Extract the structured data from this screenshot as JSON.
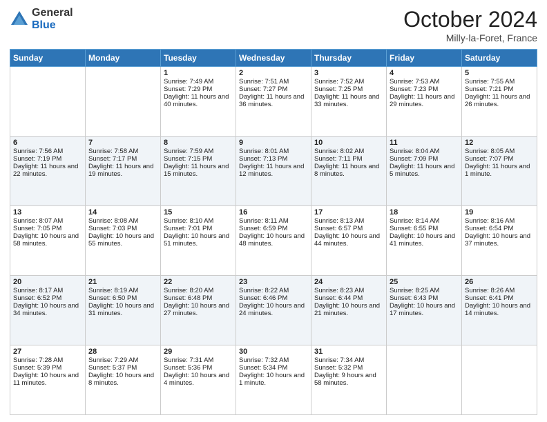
{
  "header": {
    "logo_general": "General",
    "logo_blue": "Blue",
    "main_title": "October 2024",
    "subtitle": "Milly-la-Foret, France"
  },
  "days_of_week": [
    "Sunday",
    "Monday",
    "Tuesday",
    "Wednesday",
    "Thursday",
    "Friday",
    "Saturday"
  ],
  "weeks": [
    [
      {
        "day": "",
        "info": ""
      },
      {
        "day": "",
        "info": ""
      },
      {
        "day": "1",
        "info": "Sunrise: 7:49 AM\nSunset: 7:29 PM\nDaylight: 11 hours and 40 minutes."
      },
      {
        "day": "2",
        "info": "Sunrise: 7:51 AM\nSunset: 7:27 PM\nDaylight: 11 hours and 36 minutes."
      },
      {
        "day": "3",
        "info": "Sunrise: 7:52 AM\nSunset: 7:25 PM\nDaylight: 11 hours and 33 minutes."
      },
      {
        "day": "4",
        "info": "Sunrise: 7:53 AM\nSunset: 7:23 PM\nDaylight: 11 hours and 29 minutes."
      },
      {
        "day": "5",
        "info": "Sunrise: 7:55 AM\nSunset: 7:21 PM\nDaylight: 11 hours and 26 minutes."
      }
    ],
    [
      {
        "day": "6",
        "info": "Sunrise: 7:56 AM\nSunset: 7:19 PM\nDaylight: 11 hours and 22 minutes."
      },
      {
        "day": "7",
        "info": "Sunrise: 7:58 AM\nSunset: 7:17 PM\nDaylight: 11 hours and 19 minutes."
      },
      {
        "day": "8",
        "info": "Sunrise: 7:59 AM\nSunset: 7:15 PM\nDaylight: 11 hours and 15 minutes."
      },
      {
        "day": "9",
        "info": "Sunrise: 8:01 AM\nSunset: 7:13 PM\nDaylight: 11 hours and 12 minutes."
      },
      {
        "day": "10",
        "info": "Sunrise: 8:02 AM\nSunset: 7:11 PM\nDaylight: 11 hours and 8 minutes."
      },
      {
        "day": "11",
        "info": "Sunrise: 8:04 AM\nSunset: 7:09 PM\nDaylight: 11 hours and 5 minutes."
      },
      {
        "day": "12",
        "info": "Sunrise: 8:05 AM\nSunset: 7:07 PM\nDaylight: 11 hours and 1 minute."
      }
    ],
    [
      {
        "day": "13",
        "info": "Sunrise: 8:07 AM\nSunset: 7:05 PM\nDaylight: 10 hours and 58 minutes."
      },
      {
        "day": "14",
        "info": "Sunrise: 8:08 AM\nSunset: 7:03 PM\nDaylight: 10 hours and 55 minutes."
      },
      {
        "day": "15",
        "info": "Sunrise: 8:10 AM\nSunset: 7:01 PM\nDaylight: 10 hours and 51 minutes."
      },
      {
        "day": "16",
        "info": "Sunrise: 8:11 AM\nSunset: 6:59 PM\nDaylight: 10 hours and 48 minutes."
      },
      {
        "day": "17",
        "info": "Sunrise: 8:13 AM\nSunset: 6:57 PM\nDaylight: 10 hours and 44 minutes."
      },
      {
        "day": "18",
        "info": "Sunrise: 8:14 AM\nSunset: 6:55 PM\nDaylight: 10 hours and 41 minutes."
      },
      {
        "day": "19",
        "info": "Sunrise: 8:16 AM\nSunset: 6:54 PM\nDaylight: 10 hours and 37 minutes."
      }
    ],
    [
      {
        "day": "20",
        "info": "Sunrise: 8:17 AM\nSunset: 6:52 PM\nDaylight: 10 hours and 34 minutes."
      },
      {
        "day": "21",
        "info": "Sunrise: 8:19 AM\nSunset: 6:50 PM\nDaylight: 10 hours and 31 minutes."
      },
      {
        "day": "22",
        "info": "Sunrise: 8:20 AM\nSunset: 6:48 PM\nDaylight: 10 hours and 27 minutes."
      },
      {
        "day": "23",
        "info": "Sunrise: 8:22 AM\nSunset: 6:46 PM\nDaylight: 10 hours and 24 minutes."
      },
      {
        "day": "24",
        "info": "Sunrise: 8:23 AM\nSunset: 6:44 PM\nDaylight: 10 hours and 21 minutes."
      },
      {
        "day": "25",
        "info": "Sunrise: 8:25 AM\nSunset: 6:43 PM\nDaylight: 10 hours and 17 minutes."
      },
      {
        "day": "26",
        "info": "Sunrise: 8:26 AM\nSunset: 6:41 PM\nDaylight: 10 hours and 14 minutes."
      }
    ],
    [
      {
        "day": "27",
        "info": "Sunrise: 7:28 AM\nSunset: 5:39 PM\nDaylight: 10 hours and 11 minutes."
      },
      {
        "day": "28",
        "info": "Sunrise: 7:29 AM\nSunset: 5:37 PM\nDaylight: 10 hours and 8 minutes."
      },
      {
        "day": "29",
        "info": "Sunrise: 7:31 AM\nSunset: 5:36 PM\nDaylight: 10 hours and 4 minutes."
      },
      {
        "day": "30",
        "info": "Sunrise: 7:32 AM\nSunset: 5:34 PM\nDaylight: 10 hours and 1 minute."
      },
      {
        "day": "31",
        "info": "Sunrise: 7:34 AM\nSunset: 5:32 PM\nDaylight: 9 hours and 58 minutes."
      },
      {
        "day": "",
        "info": ""
      },
      {
        "day": "",
        "info": ""
      }
    ]
  ]
}
